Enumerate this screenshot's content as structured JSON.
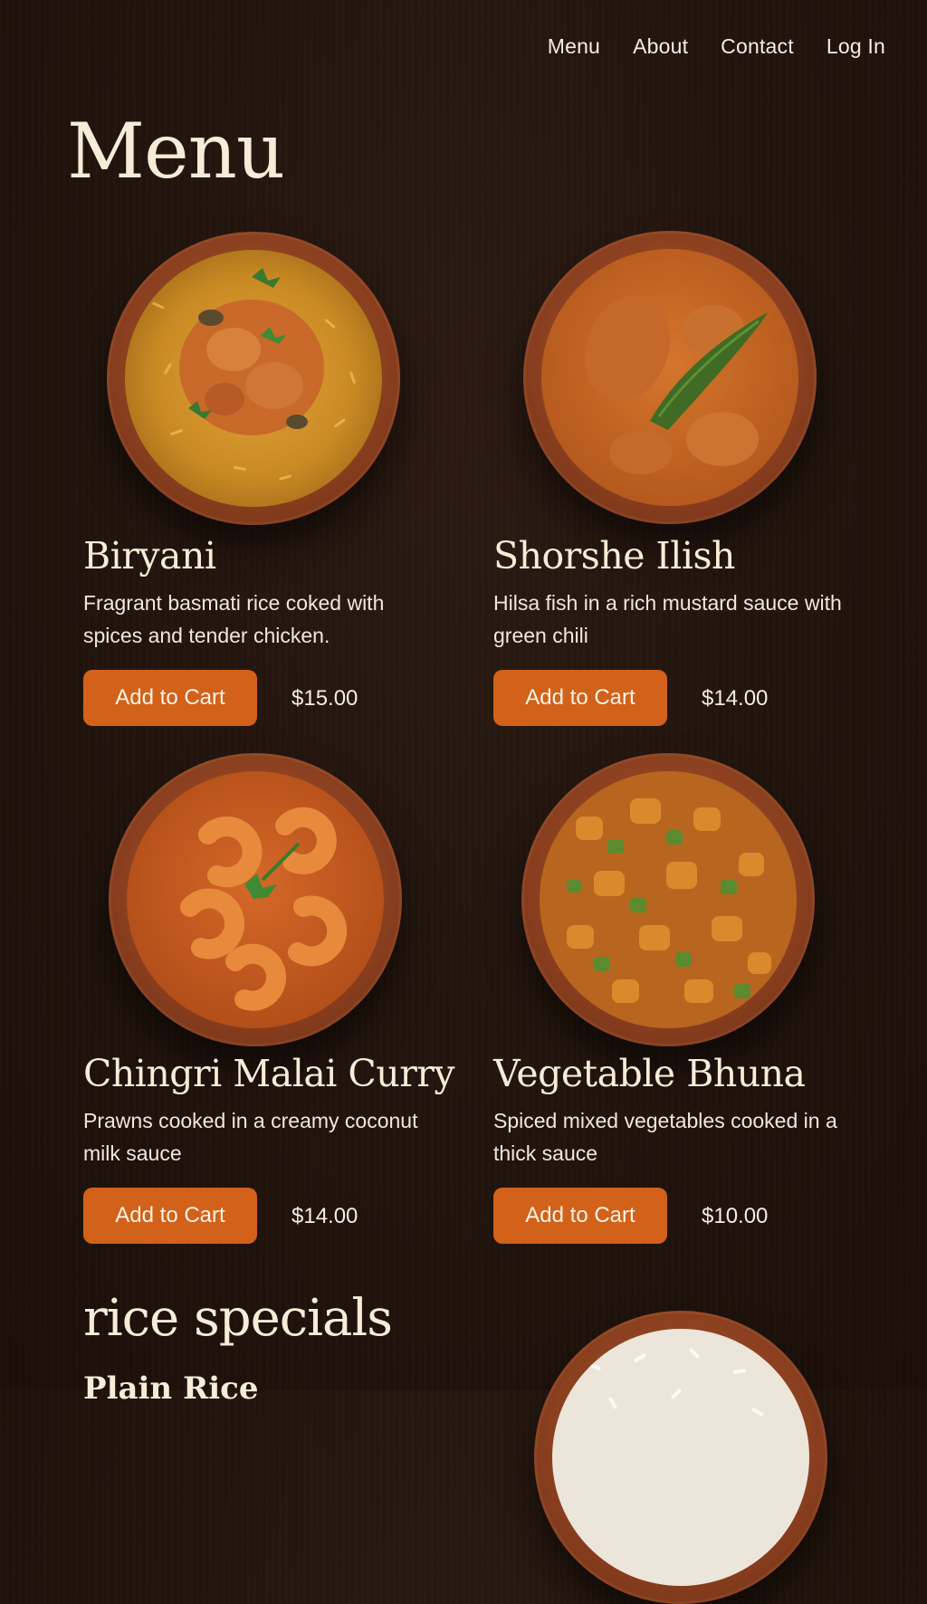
{
  "nav": {
    "items": [
      "Menu",
      "About",
      "Contact",
      "Log In"
    ]
  },
  "page_title": "Menu",
  "add_button_label": "Add to Cart",
  "dishes": [
    {
      "name": "Biryani",
      "description": "Fragrant basmati rice coked with spices and tender chicken.",
      "price": "$15.00",
      "image": "biryani-bowl"
    },
    {
      "name": "Shorshe Ilish",
      "description": "Hilsa fish in a rich mustard sauce with green chili",
      "price": "$14.00",
      "image": "mustard-fish-bowl"
    },
    {
      "name": "Chingri Malai Curry",
      "description": "Prawns cooked in a creamy coconut milk sauce",
      "price": "$14.00",
      "image": "prawn-curry-bowl"
    },
    {
      "name": "Vegetable Bhuna",
      "description": "Spiced mixed vegetables cooked in a thick sauce",
      "price": "$10.00",
      "image": "vegetable-bhuna-bowl"
    }
  ],
  "section": {
    "title": "rice specials",
    "first_item": "Plain Rice",
    "image": "plain-rice-bowl"
  },
  "colors": {
    "background": "#21140d",
    "button": "#d2611a",
    "heading": "#f6ecd8"
  }
}
